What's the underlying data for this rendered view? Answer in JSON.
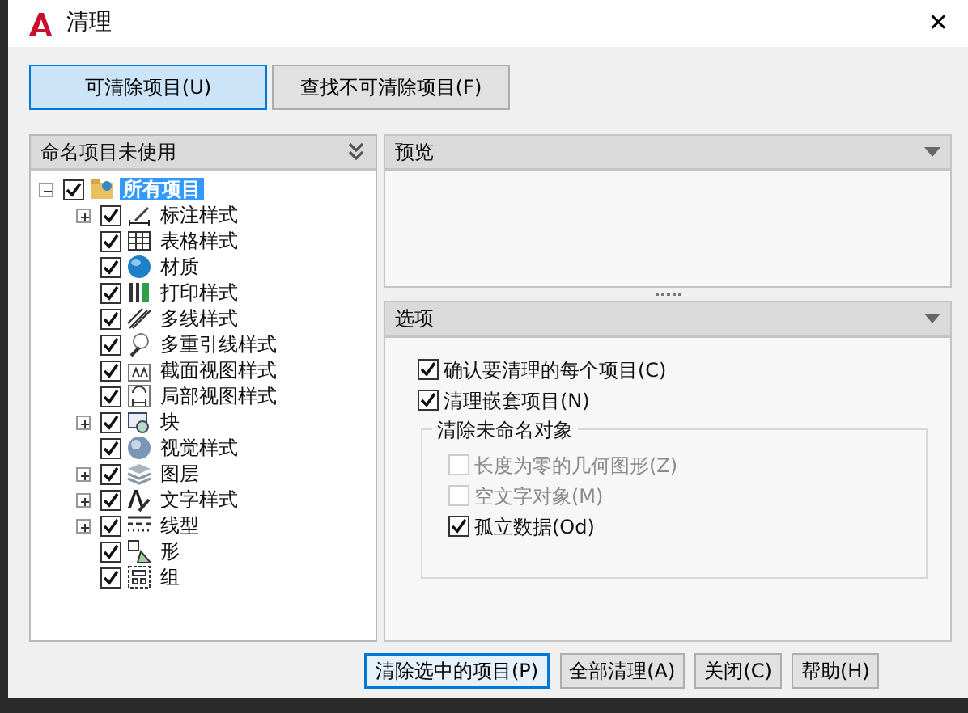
{
  "window": {
    "title": "清理",
    "close": "✕"
  },
  "tabs": [
    {
      "label": "可清除项目(U)",
      "selected": true
    },
    {
      "label": "查找不可清除项目(F)",
      "selected": false
    }
  ],
  "tree_panel": {
    "title": "命名项目未使用",
    "tree": [
      {
        "label": "所有项目",
        "checked": true,
        "selected": true,
        "expanded": true,
        "children": [
          {
            "label": "标注样式",
            "checked": true,
            "selected": false,
            "expanded": false
          },
          {
            "label": "表格样式",
            "checked": true,
            "selected": false
          },
          {
            "label": "材质",
            "checked": true,
            "selected": false
          },
          {
            "label": "打印样式",
            "checked": true,
            "selected": false
          },
          {
            "label": "多线样式",
            "checked": true,
            "selected": false
          },
          {
            "label": "多重引线样式",
            "checked": true,
            "selected": false
          },
          {
            "label": "截面视图样式",
            "checked": true,
            "selected": false
          },
          {
            "label": "局部视图样式",
            "checked": true,
            "selected": false
          },
          {
            "label": "块",
            "checked": true,
            "selected": false,
            "expanded": false
          },
          {
            "label": "视觉样式",
            "checked": true,
            "selected": false
          },
          {
            "label": "图层",
            "checked": true,
            "selected": false,
            "expanded": false
          },
          {
            "label": "文字样式",
            "checked": true,
            "selected": false,
            "expanded": false
          },
          {
            "label": "线型",
            "checked": true,
            "selected": false,
            "expanded": false
          },
          {
            "label": "形",
            "checked": true,
            "selected": false
          },
          {
            "label": "组",
            "checked": true,
            "selected": false
          }
        ]
      }
    ]
  },
  "preview_panel": {
    "title": "预览"
  },
  "options_panel": {
    "title": "选项",
    "options": [
      {
        "label": "确认要清理的每个项目(C)",
        "checked": true,
        "disabled": false
      },
      {
        "label": "清理嵌套项目(N)",
        "checked": true,
        "disabled": false
      }
    ],
    "group": {
      "title": "清除未命名对象",
      "options": [
        {
          "label": "长度为零的几何图形(Z)",
          "checked": false,
          "disabled": true
        },
        {
          "label": "空文字对象(M)",
          "checked": false,
          "disabled": true
        },
        {
          "label": "孤立数据(Od)",
          "checked": true,
          "disabled": false
        }
      ]
    }
  },
  "buttons": [
    {
      "label": "清除选中的项目(P)",
      "default": true
    },
    {
      "label": "全部清理(A)",
      "default": false
    },
    {
      "label": "关闭(C)",
      "default": false
    },
    {
      "label": "帮助(H)",
      "default": false
    }
  ]
}
